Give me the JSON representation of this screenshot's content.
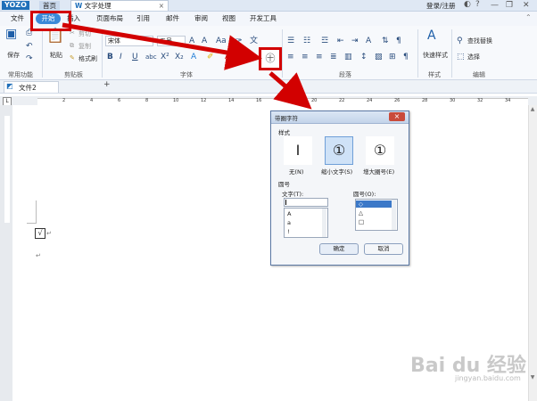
{
  "titlebar": {
    "logo": "YOZO",
    "tab_home": "首页",
    "tab_doc": "文字处理",
    "login": "登录/注册",
    "close_tab": "×",
    "min": "—",
    "restore": "❐",
    "close": "✕"
  },
  "menu": {
    "file": "文件",
    "start": "开始",
    "insert": "插入",
    "layout": "页面布局",
    "reference": "引用",
    "mail": "邮件",
    "review": "审阅",
    "view": "视图",
    "devtools": "开发工具"
  },
  "ribbon": {
    "save": "保存",
    "paste": "粘贴",
    "cut": "剪切",
    "copy": "复制",
    "format_painter": "格式刷",
    "font_name": "宋体",
    "font_size": "五号",
    "quick_style": "快速样式",
    "find_replace": "查找替换",
    "select": "选择",
    "groups": {
      "common": "常用功能",
      "clipboard": "剪贴板",
      "font": "字体",
      "paragraph": "段落",
      "style": "样式",
      "edit": "编辑"
    },
    "enclosed_char_icon": "㊉"
  },
  "doctab": {
    "name": "文件2",
    "add": "+"
  },
  "ruler": {
    "ticks": [
      "2",
      "4",
      "6",
      "8",
      "10",
      "12",
      "14",
      "16",
      "18",
      "20",
      "22",
      "24",
      "26",
      "28",
      "30",
      "32",
      "34"
    ]
  },
  "document": {
    "char": "√",
    "para_mark": "↵"
  },
  "dialog": {
    "title": "带圈字符",
    "close": "×",
    "style_label": "样式",
    "styles": [
      {
        "glyph": "I",
        "label": "无(N)"
      },
      {
        "glyph": "①",
        "label": "缩小文字(S)"
      },
      {
        "glyph": "①",
        "label": "增大圈号(E)"
      }
    ],
    "circle_label": "圆号",
    "text_label": "文字(T):",
    "text_value": "",
    "text_options": [
      "A",
      "a",
      "!"
    ],
    "circle_label2": "圆号(O):",
    "circle_options": [
      "◇",
      "△",
      "□"
    ],
    "ok": "确定",
    "cancel": "取消"
  },
  "watermark": {
    "main": "Bai du 经验",
    "sub": "jingyan.baidu.com"
  }
}
